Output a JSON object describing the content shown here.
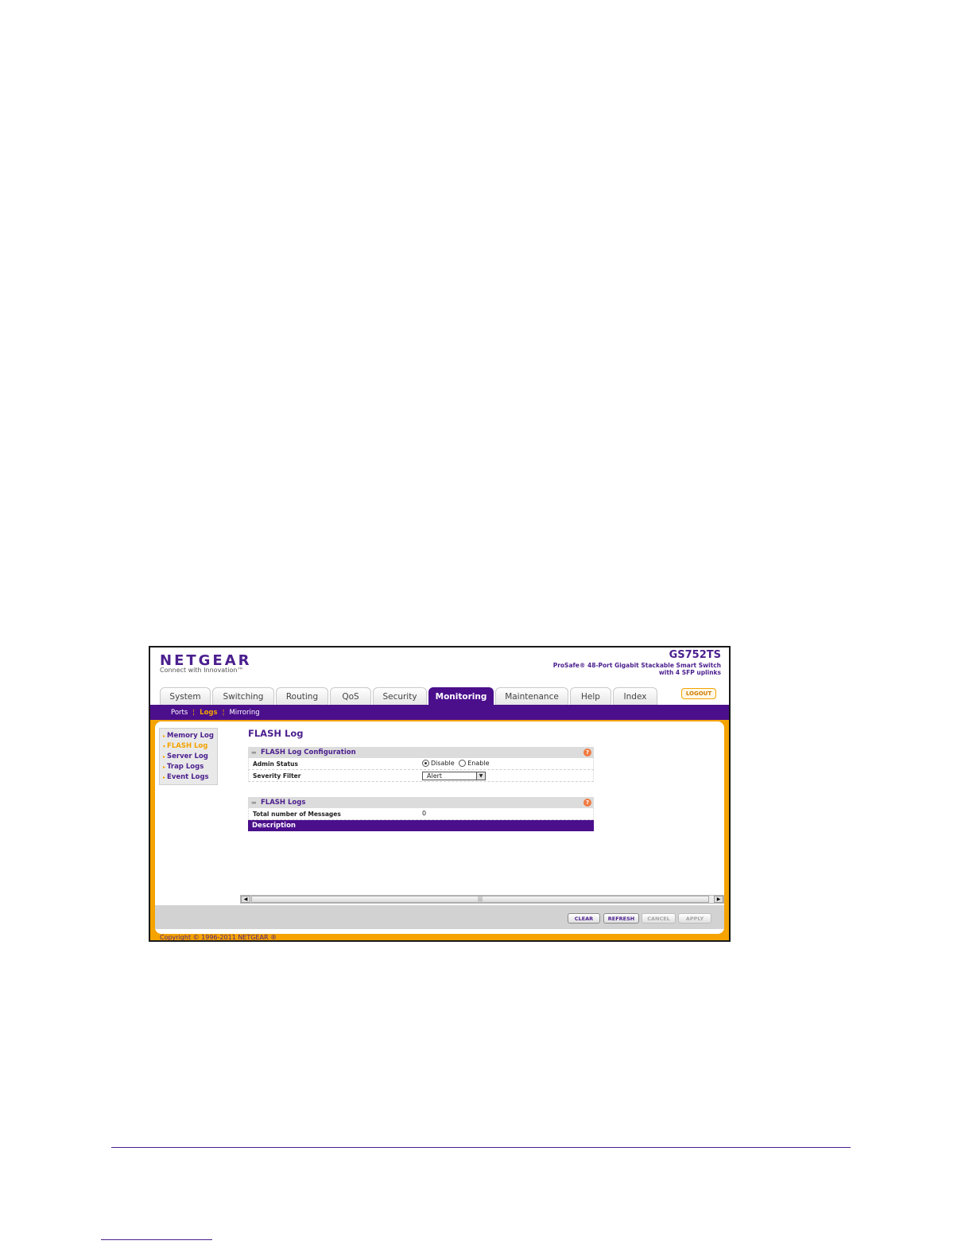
{
  "header": {
    "brand": "NETGEAR",
    "tagline": "Connect with Innovation™",
    "model": "GS752TS",
    "model_desc_line1": "ProSafe® 48-Port Gigabit Stackable Smart Switch",
    "model_desc_line2": "with 4 SFP uplinks",
    "logout_label": "LOGOUT"
  },
  "tabs": [
    {
      "label": "System"
    },
    {
      "label": "Switching"
    },
    {
      "label": "Routing"
    },
    {
      "label": "QoS"
    },
    {
      "label": "Security"
    },
    {
      "label": "Monitoring",
      "active": true
    },
    {
      "label": "Maintenance"
    },
    {
      "label": "Help"
    },
    {
      "label": "Index"
    }
  ],
  "subnav": [
    {
      "label": "Ports"
    },
    {
      "label": "Logs",
      "active": true
    },
    {
      "label": "Mirroring"
    }
  ],
  "left_menu": [
    {
      "label": "Memory Log"
    },
    {
      "label": "FLASH Log",
      "active": true
    },
    {
      "label": "Server Log"
    },
    {
      "label": "Trap Logs"
    },
    {
      "label": "Event Logs"
    }
  ],
  "page_title": "FLASH Log",
  "config_section": {
    "title": "FLASH Log Configuration",
    "admin_status_label": "Admin Status",
    "disable_label": "Disable",
    "enable_label": "Enable",
    "admin_status_value": "Disable",
    "severity_label": "Severity Filter",
    "severity_value": "Alert"
  },
  "logs_section": {
    "title": "FLASH Logs",
    "total_label": "Total number of Messages",
    "total_value": "0",
    "description_header": "Description"
  },
  "buttons": {
    "clear": "CLEAR",
    "refresh": "REFRESH",
    "cancel": "CANCEL",
    "apply": "APPLY"
  },
  "copyright": "Copyright © 1996-2011 NETGEAR ®",
  "colors": {
    "brand_purple": "#4b0f8c",
    "accent_orange": "#f4a300"
  }
}
